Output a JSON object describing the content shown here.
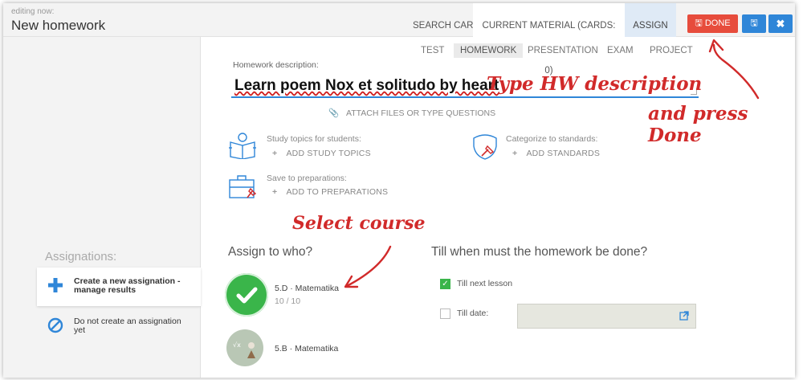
{
  "header": {
    "editing_label": "editing now:",
    "title": "New homework",
    "tabs": [
      {
        "label": "SEARCH CARDS"
      },
      {
        "label": "CURRENT MATERIAL (CARDS: 0)"
      },
      {
        "label": "ASSIGN",
        "active": true
      }
    ],
    "done_label": "DONE",
    "done_icon": "save-icon",
    "save_icon": "save-icon",
    "close_icon": "close-icon"
  },
  "material_types": [
    "TEST",
    "HOMEWORK",
    "PRESENTATION",
    "EXAM",
    "PROJECT"
  ],
  "material_types_active": "HOMEWORK",
  "homework": {
    "description_label": "Homework description:",
    "description_value": "Learn poem Nox et solitudo by heart",
    "attach_label": "ATTACH FILES OR TYPE QUESTIONS"
  },
  "blocks": {
    "study_topics": {
      "label": "Study topics for students:",
      "action": "ADD STUDY TOPICS"
    },
    "standards": {
      "label": "Categorize to standards:",
      "action": "ADD STANDARDS"
    },
    "preparations": {
      "label": "Save to preparations:",
      "action": "ADD TO PREPARATIONS"
    }
  },
  "sidebar": {
    "heading": "Assignations:",
    "options": [
      {
        "label": "Create a new assignation - manage results",
        "active": true,
        "icon": "plus-icon"
      },
      {
        "label": "Do not create an assignation yet",
        "active": false,
        "icon": "ban-icon"
      }
    ]
  },
  "assign_to": {
    "title": "Assign to who?",
    "courses": [
      {
        "name": "5.D · Matematika",
        "count": "10 / 10",
        "selected": true
      },
      {
        "name": "5.B · Matematika",
        "count": "",
        "selected": false
      }
    ]
  },
  "deadline": {
    "title": "Till when must the homework be done?",
    "next_lesson_label": "Till next lesson",
    "next_lesson_checked": true,
    "till_date_label": "Till date:",
    "till_date_checked": false,
    "till_date_value": ""
  },
  "annotations": {
    "type_hw": "Type HW description",
    "press_done": "and press Done",
    "select_course": "Select course"
  },
  "colors": {
    "accent": "#2f86d8",
    "done": "#e74c3c",
    "check": "#3ab54a",
    "annotation": "#d12a2a"
  }
}
